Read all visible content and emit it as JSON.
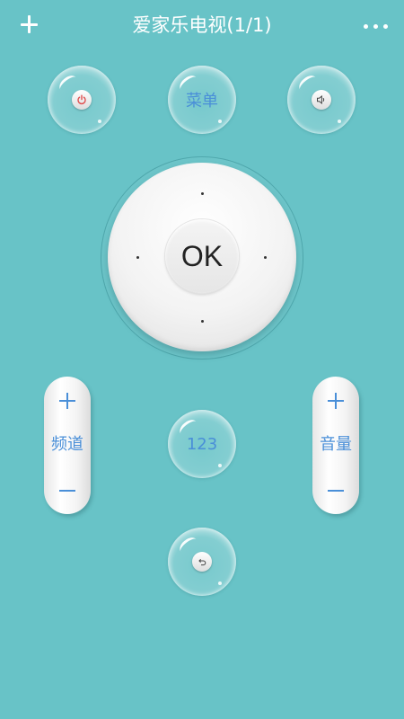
{
  "header": {
    "title": "爱家乐电视(1/1)",
    "add_icon": "plus-icon",
    "more_icon": "more-horizontal-icon"
  },
  "buttons": {
    "power_icon": "power-icon",
    "power_icon_color": "#e05050",
    "menu_label": "菜单",
    "mute_icon": "speaker-icon",
    "digits_label": "123",
    "back_icon": "back-icon"
  },
  "dpad": {
    "ok_label": "OK"
  },
  "channel": {
    "label": "频道"
  },
  "volume": {
    "label": "音量"
  },
  "colors": {
    "background": "#68c3c7",
    "accent_text": "#4a8fd8"
  }
}
